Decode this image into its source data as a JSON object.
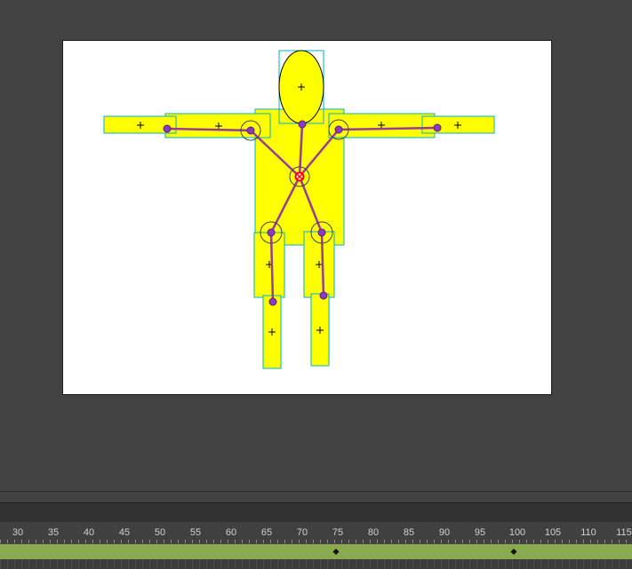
{
  "canvas": {
    "background": "#424242",
    "stage_color": "#ffffff",
    "shape_fill": "#ffff00",
    "shape_outline": "#00b3c6",
    "bone_color": "#9a3b94",
    "root_joint_color": "#ff0000"
  },
  "timeline": {
    "ruler_labels": [
      "30",
      "35",
      "40",
      "45",
      "50",
      "55",
      "60",
      "65",
      "70",
      "75",
      "80",
      "85",
      "90",
      "95",
      "100",
      "105",
      "110",
      "115"
    ],
    "keyframes": [
      "75",
      "100"
    ],
    "track_color": "#8aaa4e"
  }
}
